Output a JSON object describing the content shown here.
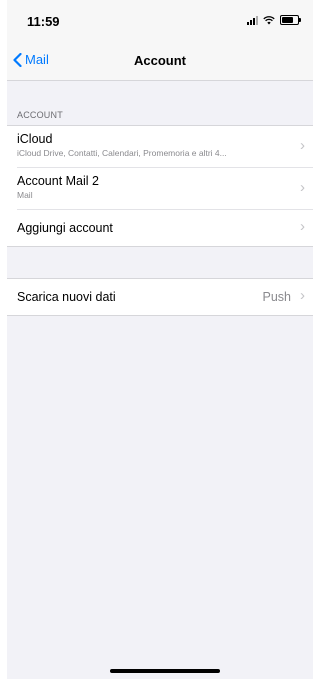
{
  "status_bar": {
    "time": "11:59"
  },
  "nav": {
    "back_label": "Mail",
    "title": "Account"
  },
  "section": {
    "header": "ACCOUNT"
  },
  "accounts": [
    {
      "title": "iCloud",
      "subtitle": "iCloud Drive, Contatti, Calendari, Promemoria e altri 4..."
    },
    {
      "title": "Account Mail 2",
      "subtitle": "Mail"
    },
    {
      "title": "Aggiungi account"
    }
  ],
  "fetch": {
    "title": "Scarica nuovi dati",
    "value": "Push"
  },
  "colors": {
    "accent": "#007aff",
    "background": "#f2f2f7"
  }
}
